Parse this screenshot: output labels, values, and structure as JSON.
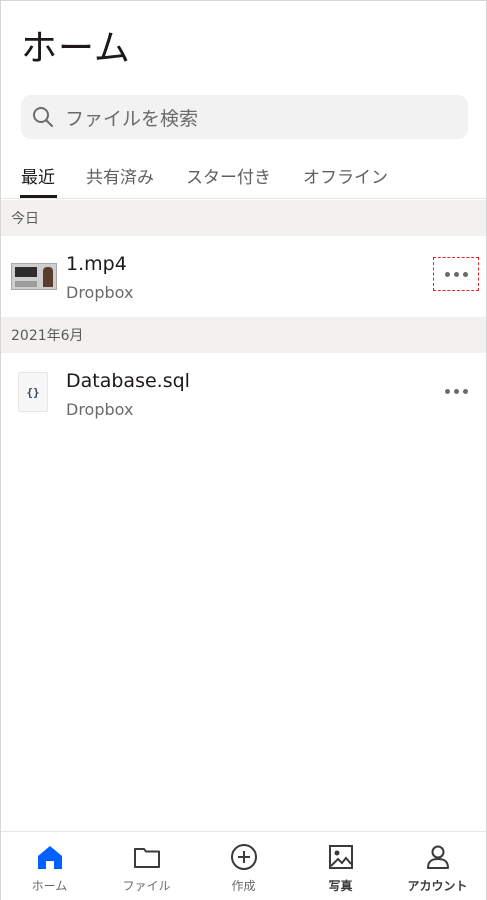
{
  "header": {
    "title": "ホーム"
  },
  "search": {
    "placeholder": "ファイルを検索"
  },
  "tabs": [
    {
      "label": "最近"
    },
    {
      "label": "共有済み"
    },
    {
      "label": "スター付き"
    },
    {
      "label": "オフライン"
    }
  ],
  "sections": [
    {
      "header": "今日",
      "files": [
        {
          "name": "1.mp4",
          "location": "Dropbox",
          "thumbnail": "video-thumbnail-icon"
        }
      ]
    },
    {
      "header": "2021年6月",
      "files": [
        {
          "name": "Database.sql",
          "location": "Dropbox",
          "thumbnail": "{}"
        }
      ]
    }
  ],
  "bottom_nav": {
    "items": [
      {
        "label": "ホーム",
        "icon": "home-icon",
        "active": true
      },
      {
        "label": "ファイル",
        "icon": "folder-icon"
      },
      {
        "label": "作成",
        "icon": "plus-circle-icon"
      },
      {
        "label": "写真",
        "icon": "photo-icon"
      },
      {
        "label": "アカウント",
        "icon": "account-icon"
      }
    ]
  },
  "colors": {
    "accent": "#0061fe",
    "highlight": "#e0262a"
  }
}
